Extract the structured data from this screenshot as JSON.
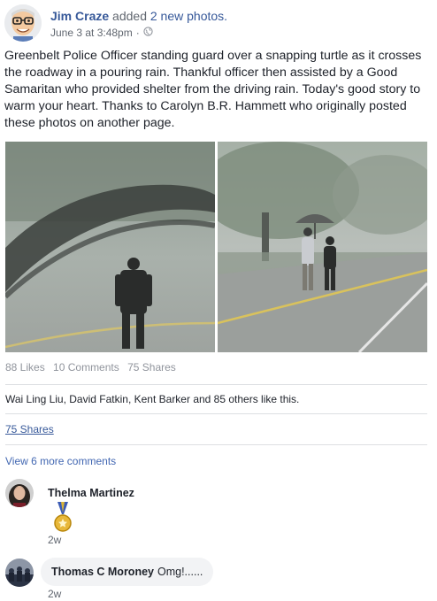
{
  "post": {
    "author": "Jim Craze",
    "action_prefix": " added ",
    "action_link": "2 new photos.",
    "date": "June 3 at 3:48pm",
    "separator": "·",
    "privacy_icon": "globe-icon",
    "text": "Greenbelt Police Officer standing guard over a snapping turtle as it crosses the roadway in a pouring rain. Thankful officer then assisted by a Good Samaritan who provided shelter from the driving rain. Today's good story to warm your heart. Thanks to Carolyn B.R. Hammett who originally posted these photos on another page."
  },
  "stats": {
    "likes": "88 Likes",
    "comments": "10 Comments",
    "shares": "75 Shares"
  },
  "likers": "Wai Ling Liu, David Fatkin, Kent Barker and 85 others like this.",
  "shares_link": "75 Shares",
  "more_comments": "View 6 more comments",
  "comments": [
    {
      "name": "Thelma Martinez",
      "text": "",
      "sticker": "medal-icon",
      "time": "2w"
    },
    {
      "name": "Thomas C Moroney",
      "text": "Omg!......",
      "time": "2w"
    }
  ],
  "colors": {
    "link": "#365899",
    "muted": "#90949c",
    "divider": "#dddfe2",
    "bubble": "#f2f3f5"
  }
}
